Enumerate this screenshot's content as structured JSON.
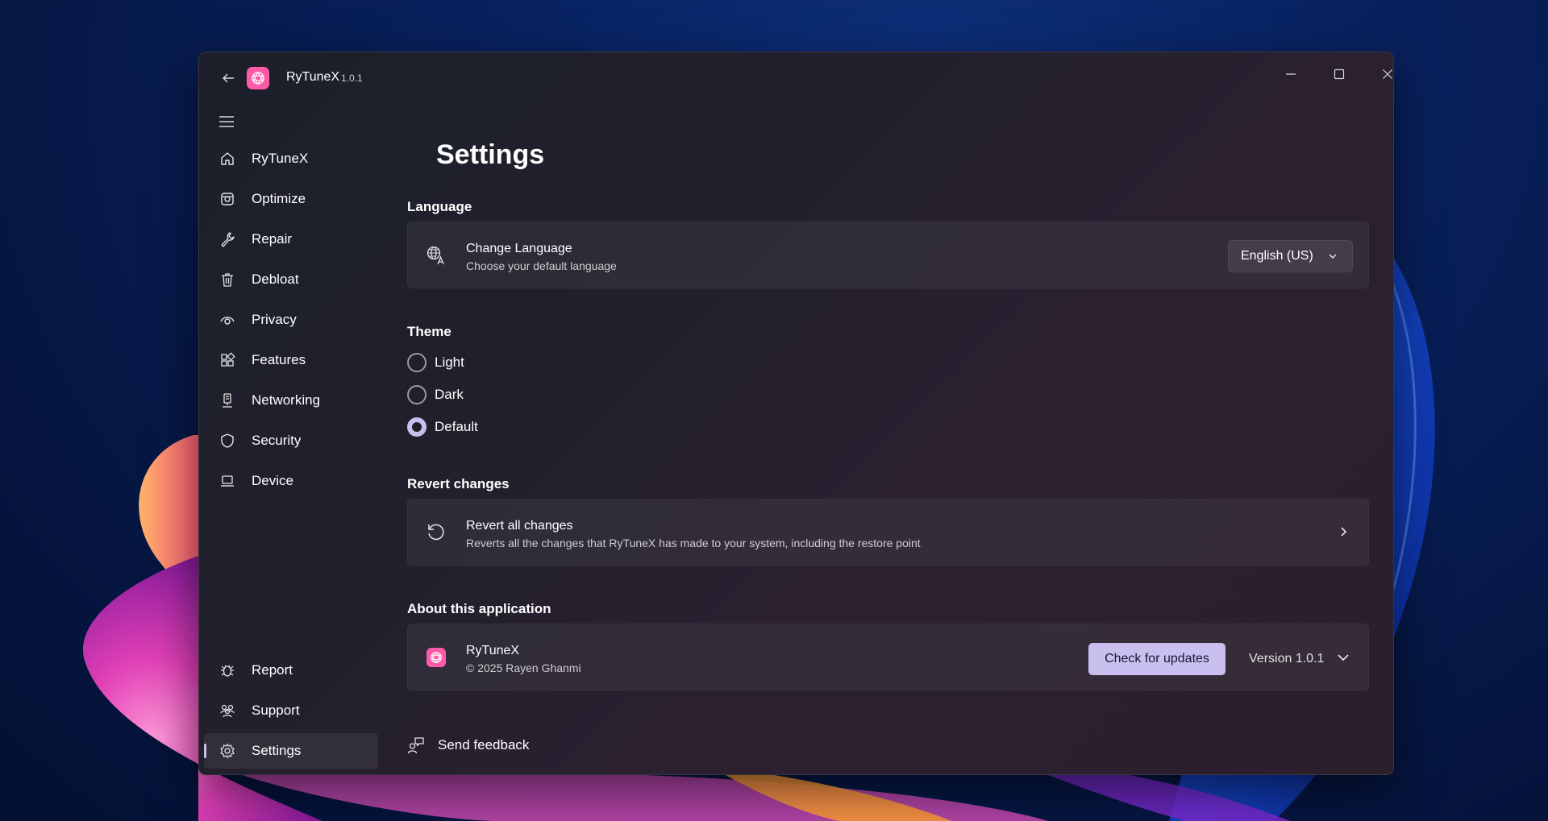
{
  "app": {
    "name": "RyTuneX",
    "version": "1.0.1"
  },
  "sidebar": {
    "items": [
      {
        "label": "RyTuneX",
        "icon": "home-icon"
      },
      {
        "label": "Optimize",
        "icon": "optimize-icon"
      },
      {
        "label": "Repair",
        "icon": "wrench-icon"
      },
      {
        "label": "Debloat",
        "icon": "trash-icon"
      },
      {
        "label": "Privacy",
        "icon": "eye-icon"
      },
      {
        "label": "Features",
        "icon": "apps-icon"
      },
      {
        "label": "Networking",
        "icon": "network-icon"
      },
      {
        "label": "Security",
        "icon": "shield-icon"
      },
      {
        "label": "Device",
        "icon": "laptop-icon"
      }
    ],
    "footer_items": [
      {
        "label": "Report",
        "icon": "bug-icon"
      },
      {
        "label": "Support",
        "icon": "people-icon"
      },
      {
        "label": "Settings",
        "icon": "gear-icon",
        "selected": true
      }
    ]
  },
  "page": {
    "title": "Settings",
    "language": {
      "section": "Language",
      "title": "Change Language",
      "description": "Choose your default language",
      "selected": "English (US)"
    },
    "theme": {
      "section": "Theme",
      "options": [
        "Light",
        "Dark",
        "Default"
      ],
      "selected": "Default"
    },
    "revert": {
      "section": "Revert changes",
      "title": "Revert all changes",
      "description": "Reverts all the changes that RyTuneX has made to your system, including the restore point"
    },
    "about": {
      "section": "About this application",
      "title": "RyTuneX",
      "copyright": "© 2025 Rayen Ghanmi",
      "update_button": "Check for updates",
      "version_label": "Version 1.0.1"
    },
    "feedback": "Send feedback"
  },
  "colors": {
    "accent": "#c9c0f0",
    "logo": "#ff5aa7"
  }
}
